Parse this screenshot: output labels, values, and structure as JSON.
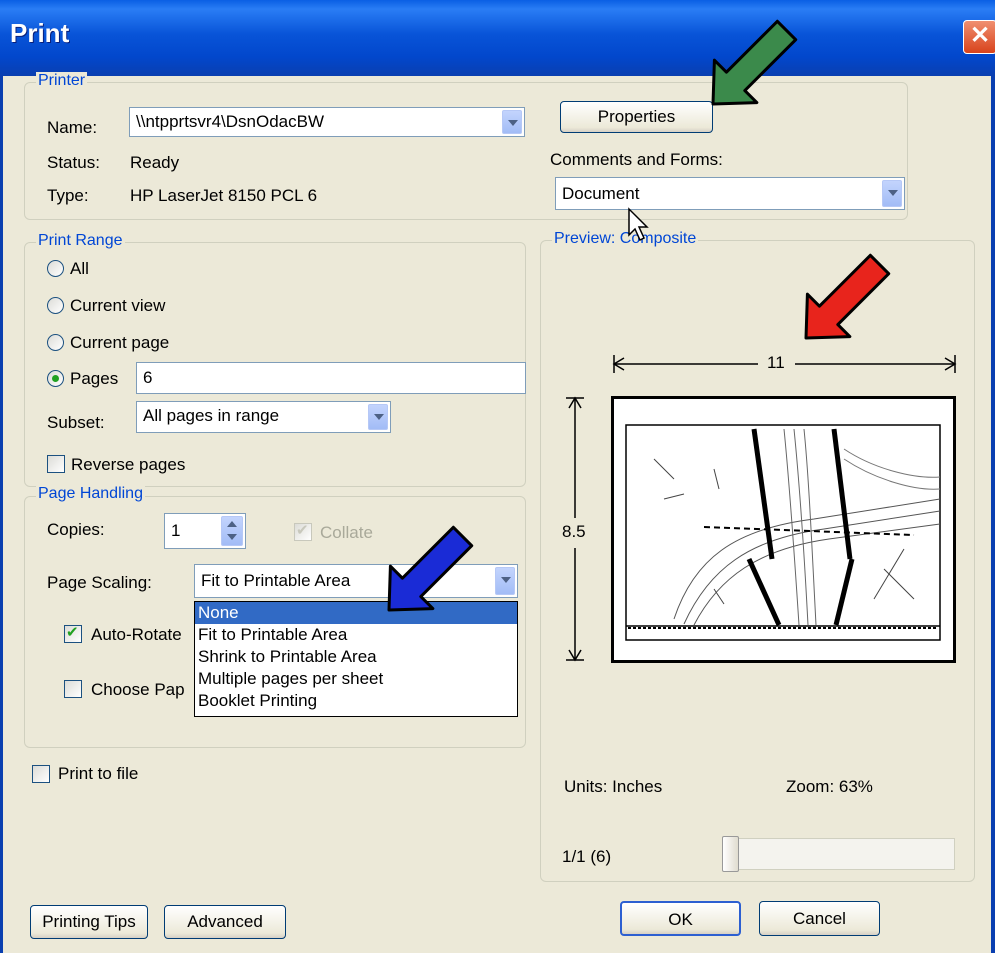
{
  "window": {
    "title": "Print"
  },
  "printer": {
    "legend": "Printer",
    "name_label": "Name:",
    "name_value": "\\\\ntpprtsvr4\\DsnOdacBW",
    "status_label": "Status:",
    "status_value": "Ready",
    "type_label": "Type:",
    "type_value": "HP LaserJet 8150 PCL 6",
    "properties_button": "Properties",
    "comments_label": "Comments and Forms:",
    "comments_value": "Document"
  },
  "print_range": {
    "legend": "Print Range",
    "all": "All",
    "current_view": "Current view",
    "current_page": "Current page",
    "pages": "Pages",
    "pages_value": "6",
    "selected": "pages",
    "subset_label": "Subset:",
    "subset_value": "All pages in range",
    "reverse_pages": "Reverse pages"
  },
  "page_handling": {
    "legend": "Page Handling",
    "copies_label": "Copies:",
    "copies_value": "1",
    "collate": "Collate",
    "scaling_label": "Page Scaling:",
    "scaling_value": "Fit to Printable Area",
    "scaling_options": [
      "None",
      "Fit to Printable Area",
      "Shrink to Printable Area",
      "Multiple pages per sheet",
      "Booklet Printing"
    ],
    "scaling_highlighted": "None",
    "auto_rotate": "Auto-Rotate",
    "choose_paper": "Choose Pap",
    "auto_rotate_checked": true,
    "choose_paper_checked": false
  },
  "print_to_file": {
    "label": "Print to file",
    "checked": false
  },
  "preview": {
    "legend": "Preview: Composite",
    "width_label": "11",
    "height_label": "8.5",
    "units": "Units: Inches",
    "zoom": "Zoom:  63%",
    "page_indicator": "1/1 (6)"
  },
  "buttons": {
    "printing_tips": "Printing Tips",
    "advanced": "Advanced",
    "ok": "OK",
    "cancel": "Cancel"
  },
  "annotation_arrows": [
    {
      "color": "#3b8a4b",
      "target": "properties-button"
    },
    {
      "color": "#e8241c",
      "target": "preview-width"
    },
    {
      "color": "#1a2bd6",
      "target": "page-scaling-dropdown"
    }
  ]
}
